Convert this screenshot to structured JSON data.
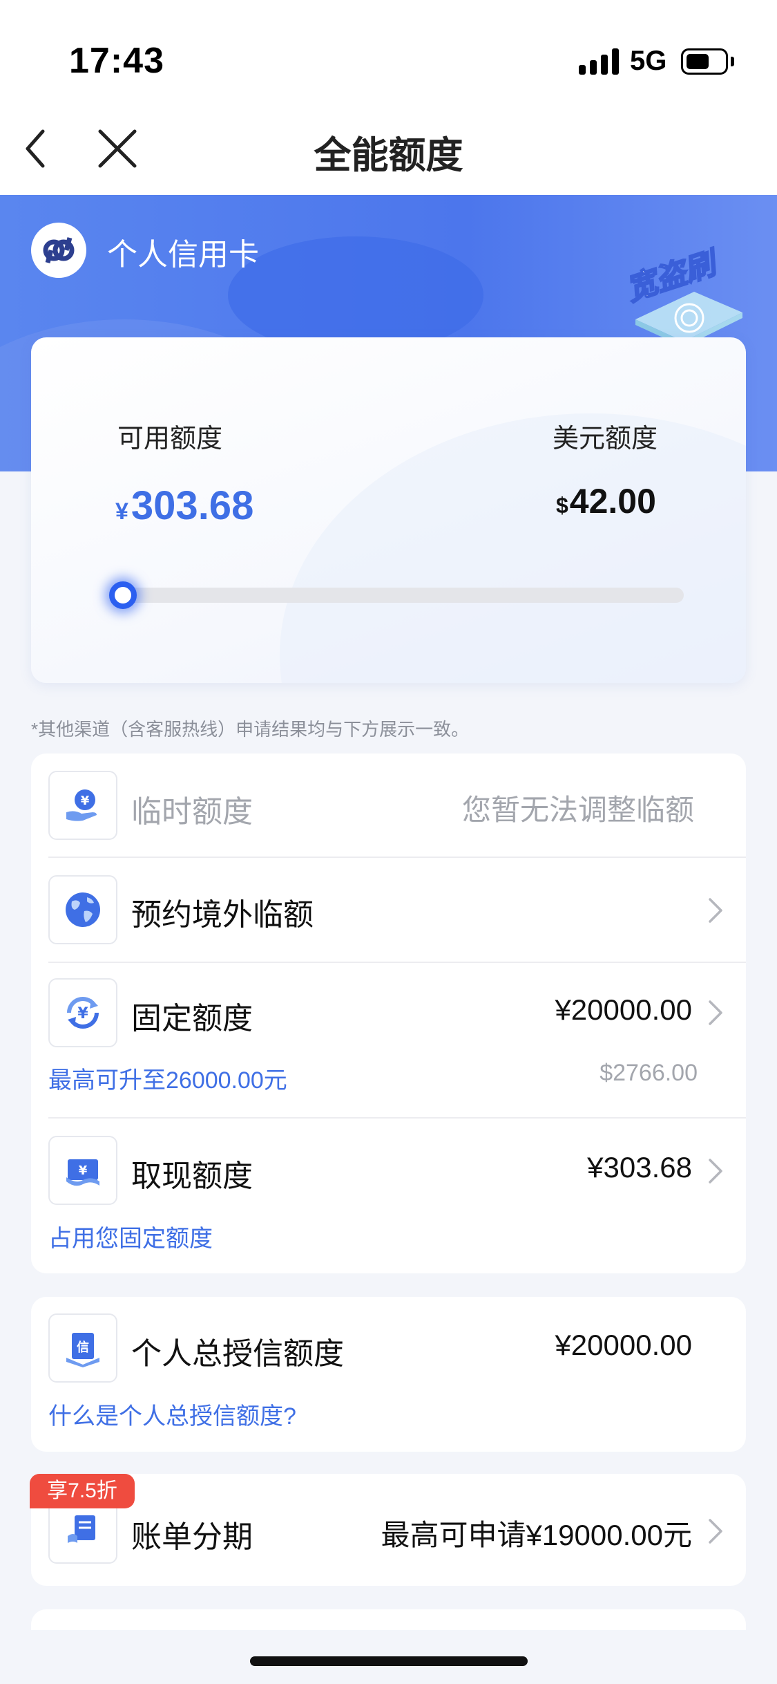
{
  "status_bar": {
    "time": "17:43",
    "network": "5G"
  },
  "nav": {
    "title": "全能额度"
  },
  "header": {
    "brand_name": "个人信用卡",
    "badge_text": "宽盗刷"
  },
  "quota_card": {
    "available_label": "可用额度",
    "available_currency": "¥",
    "available_value": "303.68",
    "usd_label": "美元额度",
    "usd_currency": "$",
    "usd_value": "42.00",
    "usage_fraction": 0.015
  },
  "notice": "*其他渠道（含客服热线）申请结果均与下方展示一致。",
  "limits": {
    "temporary": {
      "label": "临时额度",
      "value": "您暂无法调整临额"
    },
    "overseas": {
      "label": "预约境外临额"
    },
    "fixed": {
      "label": "固定额度",
      "value": "¥20000.00",
      "sub_left": "最高可升至26000.00元",
      "sub_right": "$2766.00"
    },
    "cash": {
      "label": "取现额度",
      "value": "¥303.68",
      "sub_left": "占用您固定额度"
    }
  },
  "total_credit": {
    "label": "个人总授信额度",
    "value": "¥20000.00",
    "help_link": "什么是个人总授信额度?"
  },
  "installment": {
    "badge": "享7.5折",
    "label": "账单分期",
    "value": "最高可申请¥19000.00元"
  },
  "colors": {
    "accent": "#3f6fe5",
    "header": "#4c76ec",
    "promo": "#ef4c3f"
  },
  "icons": {
    "temporary": "yen-hand-icon",
    "overseas": "globe-icon",
    "fixed": "yen-cycle-icon",
    "cash": "cash-note-icon",
    "total_credit": "credit-document-icon",
    "installment": "bill-scroll-icon"
  }
}
